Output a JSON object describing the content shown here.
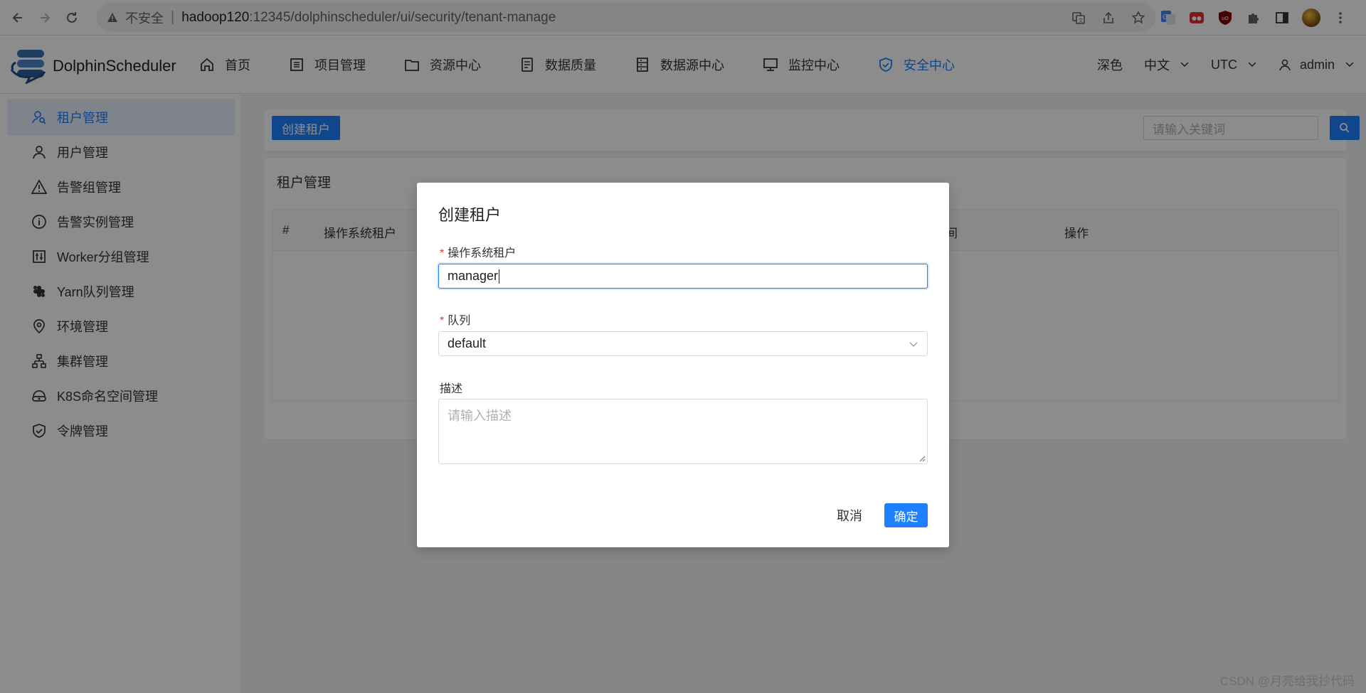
{
  "browser": {
    "security_label": "不安全",
    "url_host": "hadoop120",
    "url_rest": ":12345/dolphinscheduler/ui/security/tenant-manage"
  },
  "app": {
    "logo_text": "DolphinScheduler",
    "nav": [
      {
        "label": "首页",
        "icon": "home-icon"
      },
      {
        "label": "项目管理",
        "icon": "list-icon"
      },
      {
        "label": "资源中心",
        "icon": "folder-icon"
      },
      {
        "label": "数据质量",
        "icon": "document-icon"
      },
      {
        "label": "数据源中心",
        "icon": "database-icon"
      },
      {
        "label": "监控中心",
        "icon": "monitor-icon"
      },
      {
        "label": "安全中心",
        "icon": "shield-icon",
        "active": true
      }
    ],
    "theme_label": "深色",
    "language": "中文",
    "timezone": "UTC",
    "user": "admin",
    "accent_color": "#1e80ff"
  },
  "sidebar": {
    "items": [
      {
        "label": "租户管理",
        "icon": "tenant-icon",
        "active": true
      },
      {
        "label": "用户管理",
        "icon": "user-icon"
      },
      {
        "label": "告警组管理",
        "icon": "warning-icon"
      },
      {
        "label": "告警实例管理",
        "icon": "info-icon"
      },
      {
        "label": "Worker分组管理",
        "icon": "worker-group-icon"
      },
      {
        "label": "Yarn队列管理",
        "icon": "queue-icon"
      },
      {
        "label": "环境管理",
        "icon": "location-icon"
      },
      {
        "label": "集群管理",
        "icon": "cluster-icon"
      },
      {
        "label": "K8S命名空间管理",
        "icon": "namespace-icon"
      },
      {
        "label": "令牌管理",
        "icon": "token-shield-icon"
      }
    ]
  },
  "main": {
    "create_button": "创建租户",
    "search_placeholder": "请输入关键词",
    "card_title": "租户管理",
    "table_headers": [
      "#",
      "操作系统租户",
      "更新时间",
      "操作"
    ]
  },
  "modal": {
    "title": "创建租户",
    "tenant_label": "操作系统租户",
    "tenant_value": "manager",
    "queue_label": "队列",
    "queue_value": "default",
    "desc_label": "描述",
    "desc_placeholder": "请输入描述",
    "cancel_label": "取消",
    "ok_label": "确定"
  },
  "watermark": "CSDN @月亮给我抄代码"
}
